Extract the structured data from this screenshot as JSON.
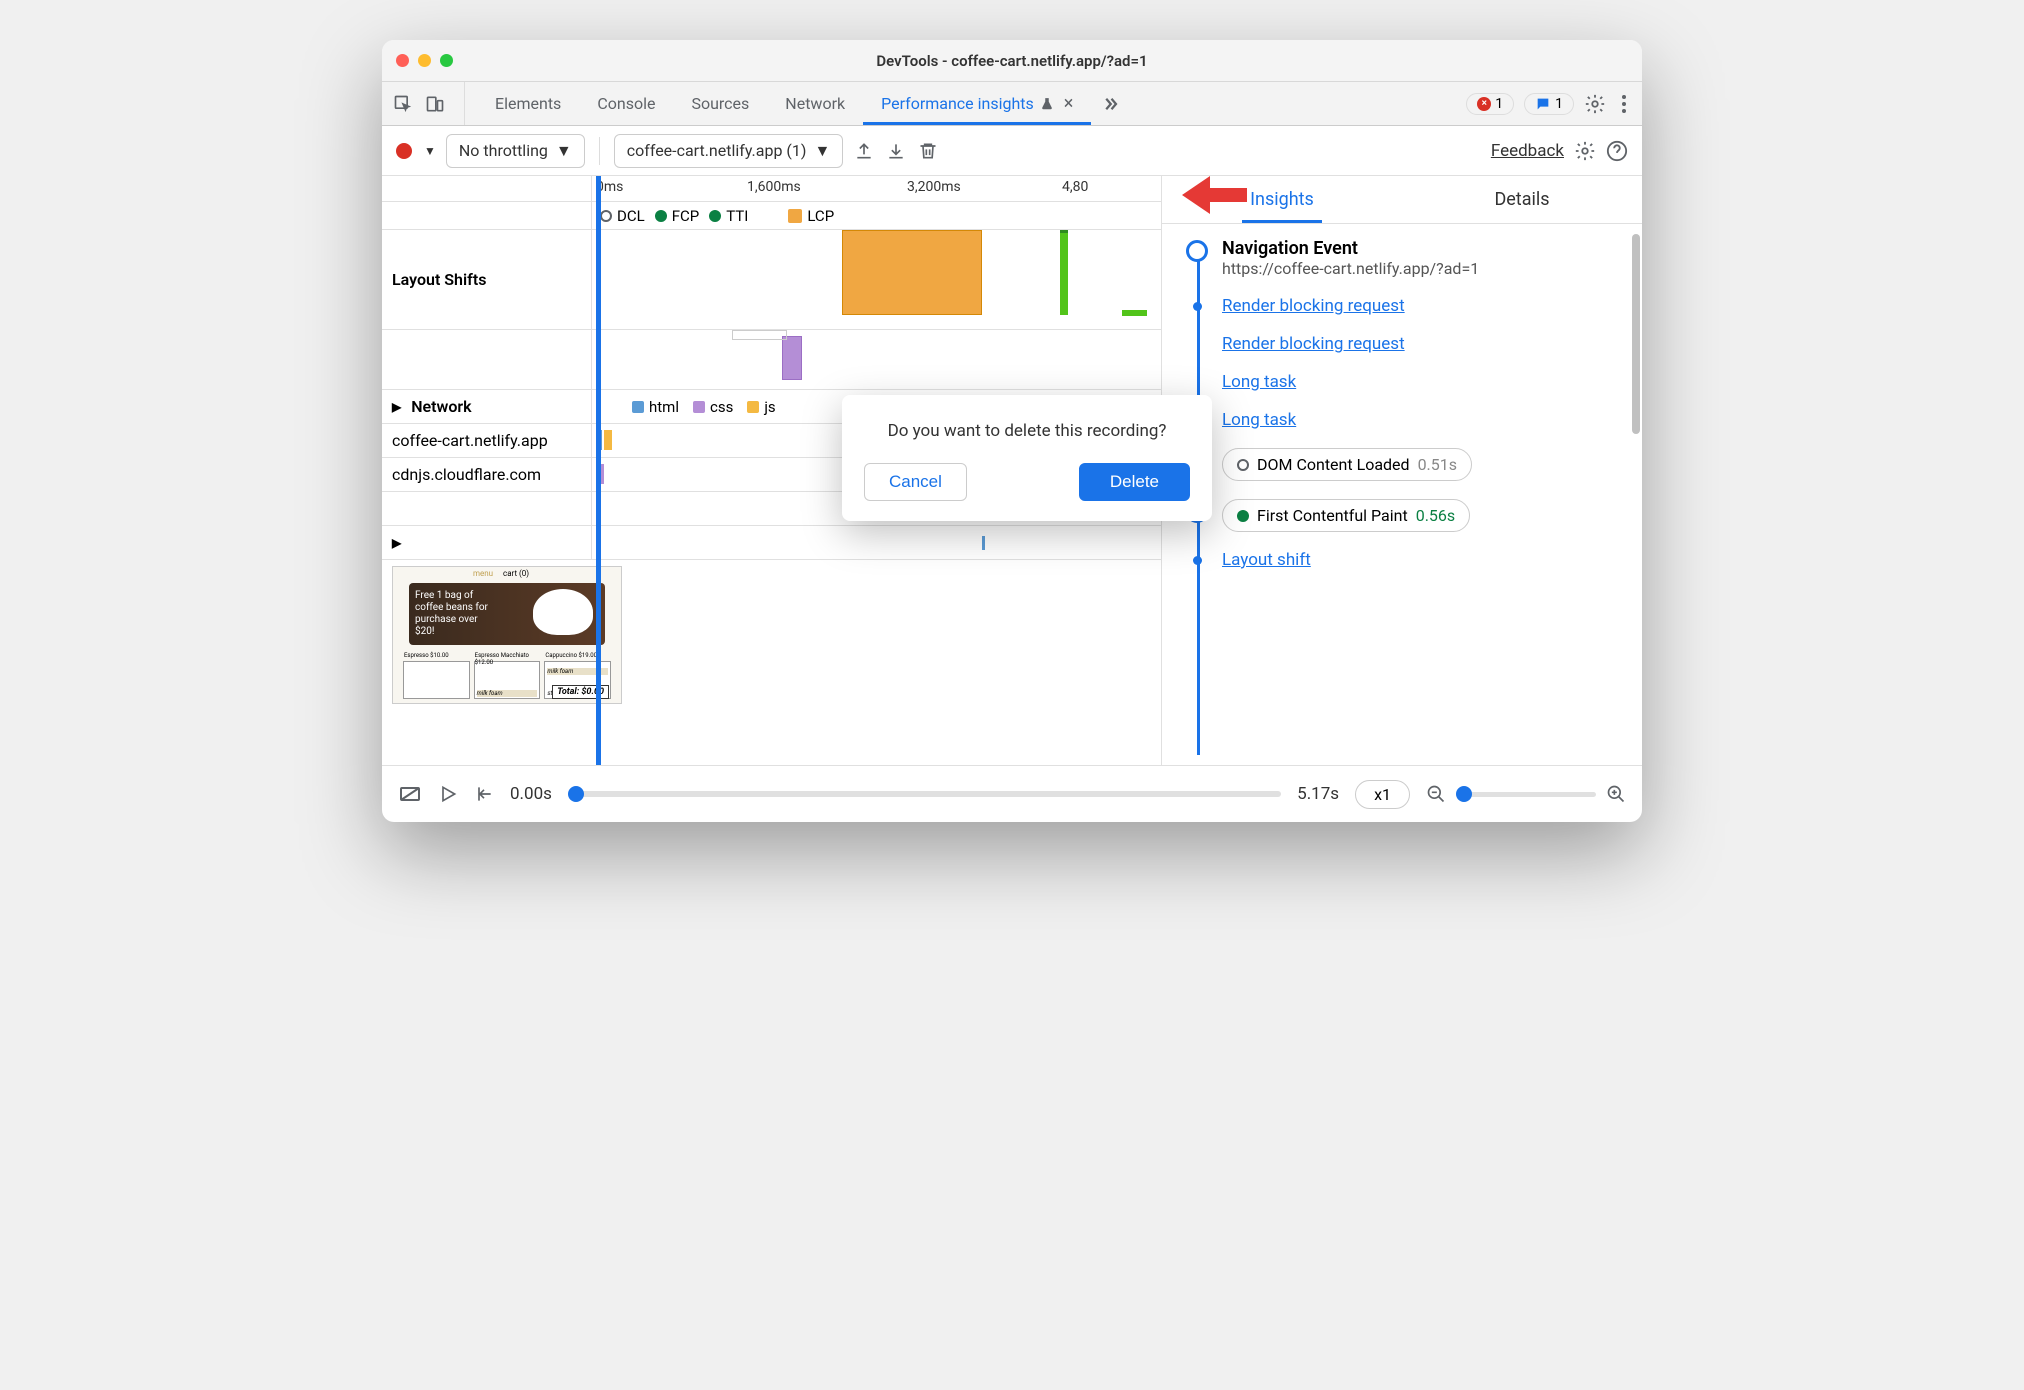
{
  "window": {
    "title": "DevTools - coffee-cart.netlify.app/?ad=1"
  },
  "devtools_tabs": {
    "items": [
      "Elements",
      "Console",
      "Sources",
      "Network",
      "Performance insights"
    ],
    "active_index": 4,
    "error_count": "1",
    "message_count": "1"
  },
  "toolbar": {
    "throttling": "No throttling",
    "recording_name": "coffee-cart.netlify.app (1)",
    "feedback": "Feedback"
  },
  "ruler": {
    "ticks": [
      "0ms",
      "1,600ms",
      "3,200ms",
      "4,80"
    ]
  },
  "markers": [
    {
      "label": "DCL",
      "type": "open"
    },
    {
      "label": "FCP",
      "color": "#0b8043"
    },
    {
      "label": "TTI",
      "color": "#0b8043"
    },
    {
      "label": "LCP",
      "color": "#f0a742",
      "shape": "square"
    }
  ],
  "rows": {
    "layout_shifts": "Layout Shifts",
    "network": "Network",
    "net_filters": [
      {
        "label": "html",
        "color": "#5b9bd5"
      },
      {
        "label": "css",
        "color": "#b48ed6"
      },
      {
        "label": "js",
        "color": "#f4b942"
      }
    ],
    "domains": [
      "coffee-cart.netlify.app",
      "cdnjs.cloudflare.com"
    ]
  },
  "thumb": {
    "banner": "Free 1 bag of coffee beans for purchase over $20!",
    "products": [
      "Espresso $10.00",
      "Espresso Macchiato $12.00",
      "Cappuccino $19.00"
    ],
    "milk_foam": "milk foam",
    "steamed": "steamed",
    "total": "Total: $0.00",
    "menu": "menu",
    "cart": "cart (0)"
  },
  "right_panel": {
    "tabs": [
      "Insights",
      "Details"
    ],
    "nav_event": {
      "title": "Navigation Event",
      "url": "https://coffee-cart.netlify.app/?ad=1"
    },
    "items": [
      {
        "type": "link",
        "text": "Render blocking request"
      },
      {
        "type": "link",
        "text": "Render blocking request"
      },
      {
        "type": "link",
        "text": "Long task"
      },
      {
        "type": "link",
        "text": "Long task"
      },
      {
        "type": "pill",
        "label": "DOM Content Loaded",
        "time": "0.51s",
        "marker": "open"
      },
      {
        "type": "pill",
        "label": "First Contentful Paint",
        "time": "0.56s",
        "marker": "green"
      },
      {
        "type": "link",
        "text": "Layout shift"
      }
    ]
  },
  "footer": {
    "start": "0.00s",
    "end": "5.17s",
    "speed": "x1"
  },
  "dialog": {
    "message": "Do you want to delete this recording?",
    "cancel": "Cancel",
    "delete": "Delete"
  }
}
